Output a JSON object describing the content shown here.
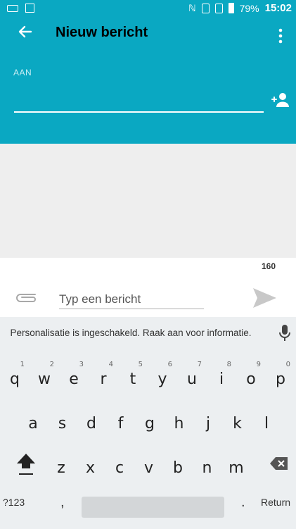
{
  "status_bar": {
    "battery": "79%",
    "time": "15:02"
  },
  "app_bar": {
    "title": "Nieuw bericht"
  },
  "recipient": {
    "label": "AAN",
    "value": ""
  },
  "compose": {
    "counter": "160",
    "placeholder": "Typ een bericht"
  },
  "keyboard": {
    "suggestion": "Personalisatie is ingeschakeld. Raak aan voor informatie.",
    "row1": [
      {
        "key": "q",
        "hint": "1"
      },
      {
        "key": "w",
        "hint": "2"
      },
      {
        "key": "e",
        "hint": "3"
      },
      {
        "key": "r",
        "hint": "4"
      },
      {
        "key": "t",
        "hint": "5"
      },
      {
        "key": "y",
        "hint": "6"
      },
      {
        "key": "u",
        "hint": "7"
      },
      {
        "key": "i",
        "hint": "8"
      },
      {
        "key": "o",
        "hint": "9"
      },
      {
        "key": "p",
        "hint": "0"
      }
    ],
    "row2": [
      "a",
      "s",
      "d",
      "f",
      "g",
      "h",
      "j",
      "k",
      "l"
    ],
    "row3": [
      "z",
      "x",
      "c",
      "v",
      "b",
      "n",
      "m"
    ],
    "num_sym": "?123",
    "comma": ",",
    "period": ".",
    "return": "Return"
  },
  "colors": {
    "accent": "#0aa8c2",
    "thread_bg": "#eeeeee",
    "keyboard_bg": "#eceff1"
  },
  "icons": [
    "keyboard-icon",
    "image-icon",
    "nfc-icon",
    "sim-icon",
    "battery-icon",
    "back-arrow-icon",
    "overflow-menu-icon",
    "add-contact-icon",
    "paperclip-icon",
    "send-icon",
    "mic-icon",
    "shift-icon",
    "backspace-icon"
  ]
}
